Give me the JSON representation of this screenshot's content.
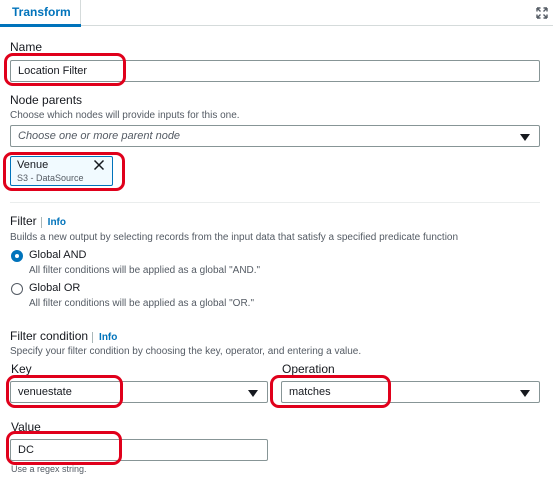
{
  "tabs": [
    {
      "label": "Transform"
    }
  ],
  "name": {
    "label": "Name",
    "value": "Location Filter"
  },
  "node_parents": {
    "label": "Node parents",
    "description": "Choose which nodes will provide inputs for this one.",
    "placeholder": "Choose one or more parent node",
    "selected": {
      "title": "Venue",
      "subtitle": "S3 - DataSource"
    }
  },
  "filter": {
    "label": "Filter",
    "info": "Info",
    "description": "Builds a new output by selecting records from the input data that satisfy a specified predicate function",
    "options": [
      {
        "label": "Global AND",
        "description": "All filter conditions will be applied as a global \"AND.\"",
        "checked": true
      },
      {
        "label": "Global OR",
        "description": "All filter conditions will be applied as a global \"OR.\"",
        "checked": false
      }
    ]
  },
  "filter_condition": {
    "label": "Filter condition",
    "info": "Info",
    "description": "Specify your filter condition by choosing the key, operator, and entering a value.",
    "key": {
      "label": "Key",
      "value": "venuestate"
    },
    "operation": {
      "label": "Operation",
      "value": "matches"
    },
    "value": {
      "label": "Value",
      "value": "DC",
      "hint": "Use a regex string."
    }
  },
  "colors": {
    "accent": "#0073bb",
    "highlight": "#e0001b"
  }
}
